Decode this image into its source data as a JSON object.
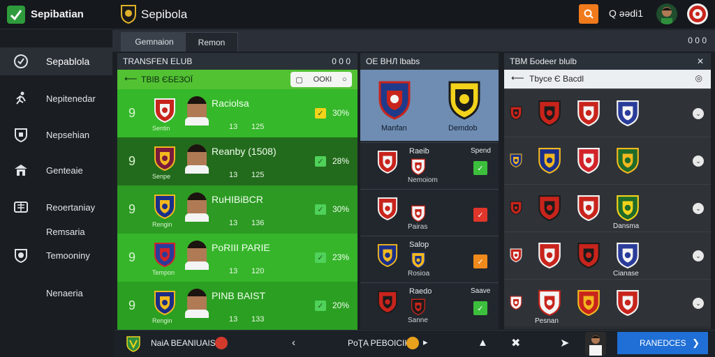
{
  "app": {
    "title": "Sepibatian",
    "game_title": "Sepibola",
    "user_label": "Q əədi1"
  },
  "sidebar": {
    "items": [
      {
        "label": "Sepablola",
        "icon": "clock-check-icon",
        "active": true
      },
      {
        "label": "Nepitenedar",
        "icon": "sprint-icon"
      },
      {
        "label": "Nepsehian",
        "icon": "shield-badge-icon"
      },
      {
        "label": "Genteaie",
        "icon": "building-icon"
      },
      {
        "label": "Reoertaniay",
        "icon": "stadium-icon"
      },
      {
        "label": "Remsaria",
        "icon": ""
      },
      {
        "label": "Temooniny",
        "icon": "ball-shield-icon"
      },
      {
        "label": "Nenaeria",
        "icon": ""
      }
    ]
  },
  "tabs": [
    {
      "label": "Gemnaion"
    },
    {
      "label": "Remon"
    }
  ],
  "tabs_right": "0 0 0",
  "panel1": {
    "title": "TRANSFEN ЕLUB",
    "head_right": "0 0 0",
    "sub_title": "TBIB ЄБЕЗОЇ",
    "filter_label": "OOКI",
    "rows": [
      {
        "num": "9",
        "crest_label": "Sentin",
        "name": "Raciolsa",
        "a": "13",
        "b": "125",
        "pct": "30%",
        "check_color": "#f2d21b",
        "crest_colors": [
          "#c8241c",
          "#f4f4f4"
        ]
      },
      {
        "num": "9",
        "crest_label": "Senpe",
        "name": "Reanby (1508)",
        "a": "13",
        "b": "125",
        "pct": "28%",
        "check_color": "#4fd15a",
        "crest_colors": [
          "#7a1a3c",
          "#f2b81e"
        ]
      },
      {
        "num": "9",
        "crest_label": "Rengin",
        "name": "RuHIBiBCR",
        "a": "13",
        "b": "136",
        "pct": "30%",
        "check_color": "#4fd15a",
        "crest_colors": [
          "#1a2f8a",
          "#f2b81e"
        ]
      },
      {
        "num": "9",
        "crest_label": "Tempon",
        "name": "PoRIII PARIE",
        "a": "13",
        "b": "120",
        "pct": "23%",
        "check_color": "#4fd15a",
        "crest_colors": [
          "#2a3c9a",
          "#d2232a"
        ]
      },
      {
        "num": "9",
        "crest_label": "Rengin",
        "name": "PINB BAIST",
        "a": "13",
        "b": "133",
        "pct": "20%",
        "check_color": "#4fd15a",
        "crest_colors": [
          "#1b2d85",
          "#f2b81e"
        ]
      }
    ]
  },
  "panel2": {
    "title": "OE ВНЛ lbabs",
    "top_left_label": "Manfan",
    "top_right_label": "Demdob",
    "rows": [
      {
        "t1": "Raeib",
        "t2": "Nemoiom",
        "tr": "Spend",
        "sq_color": "#3cbf3c",
        "crest_colors": [
          "#c8241c",
          "#f4f4f4"
        ]
      },
      {
        "t1": "",
        "t2": "Pairas",
        "tr": "",
        "sq_color": "#e0352a",
        "crest_colors": [
          "#c8241c",
          "#f4f4f4"
        ]
      },
      {
        "t1": "Salop",
        "t2": "Rosioa",
        "tr": "",
        "sq_color": "#f08a1c",
        "crest_colors": [
          "#1a2f8a",
          "#f2b81e"
        ]
      },
      {
        "t1": "Raedo",
        "t2": "Sanne",
        "tr": "Saave",
        "sq_color": "#3cbf3c",
        "crest_colors": [
          "#c8241c",
          "#1b1b1b"
        ]
      }
    ]
  },
  "panel3": {
    "title": "TBM Боdeer blulb",
    "sub_title": "Tbyce Є Bacdl",
    "rows": [
      {
        "labels": [
          "",
          "",
          ""
        ],
        "crests": [
          [
            "#c8241c",
            "#1b1b1b"
          ],
          [
            "#c8241c",
            "#f4f4f4"
          ],
          [
            "#2a3c9a",
            "#f4f4f4"
          ]
        ]
      },
      {
        "labels": [
          "",
          "",
          ""
        ],
        "crests": [
          [
            "#1a2f8a",
            "#f2b81e"
          ],
          [
            "#d2232a",
            "#f4f4f4"
          ],
          [
            "#1f6b2a",
            "#f2b81e"
          ]
        ]
      },
      {
        "labels": [
          "",
          "",
          "Dansma"
        ],
        "crests": [
          [
            "#c8241c",
            "#1b1b1b"
          ],
          [
            "#c8241c",
            "#f4f4f4"
          ],
          [
            "#1f6b2a",
            "#f2d21b"
          ]
        ]
      },
      {
        "labels": [
          "",
          "",
          "Cianase"
        ],
        "crests": [
          [
            "#c8241c",
            "#f4f4f4"
          ],
          [
            "#c8241c",
            "#1b1b1b"
          ],
          [
            "#2a3c9a",
            "#f4f4f4"
          ]
        ]
      },
      {
        "labels": [
          "Pesnan",
          "",
          ""
        ],
        "crests": [
          [
            "#f4f4f4",
            "#c8241c"
          ],
          [
            "#c8241c",
            "#f2b81e"
          ],
          [
            "#c8241c",
            "#f4f4f4"
          ]
        ]
      }
    ]
  },
  "bottom": {
    "team": "NaiA BEANIUAIS",
    "mid": "PoƮA PEBOICIK",
    "cta": "RANEDCES"
  },
  "colors": {
    "accent": "#f07a1c",
    "green": "#52c233",
    "cta": "#1f6fd6"
  }
}
